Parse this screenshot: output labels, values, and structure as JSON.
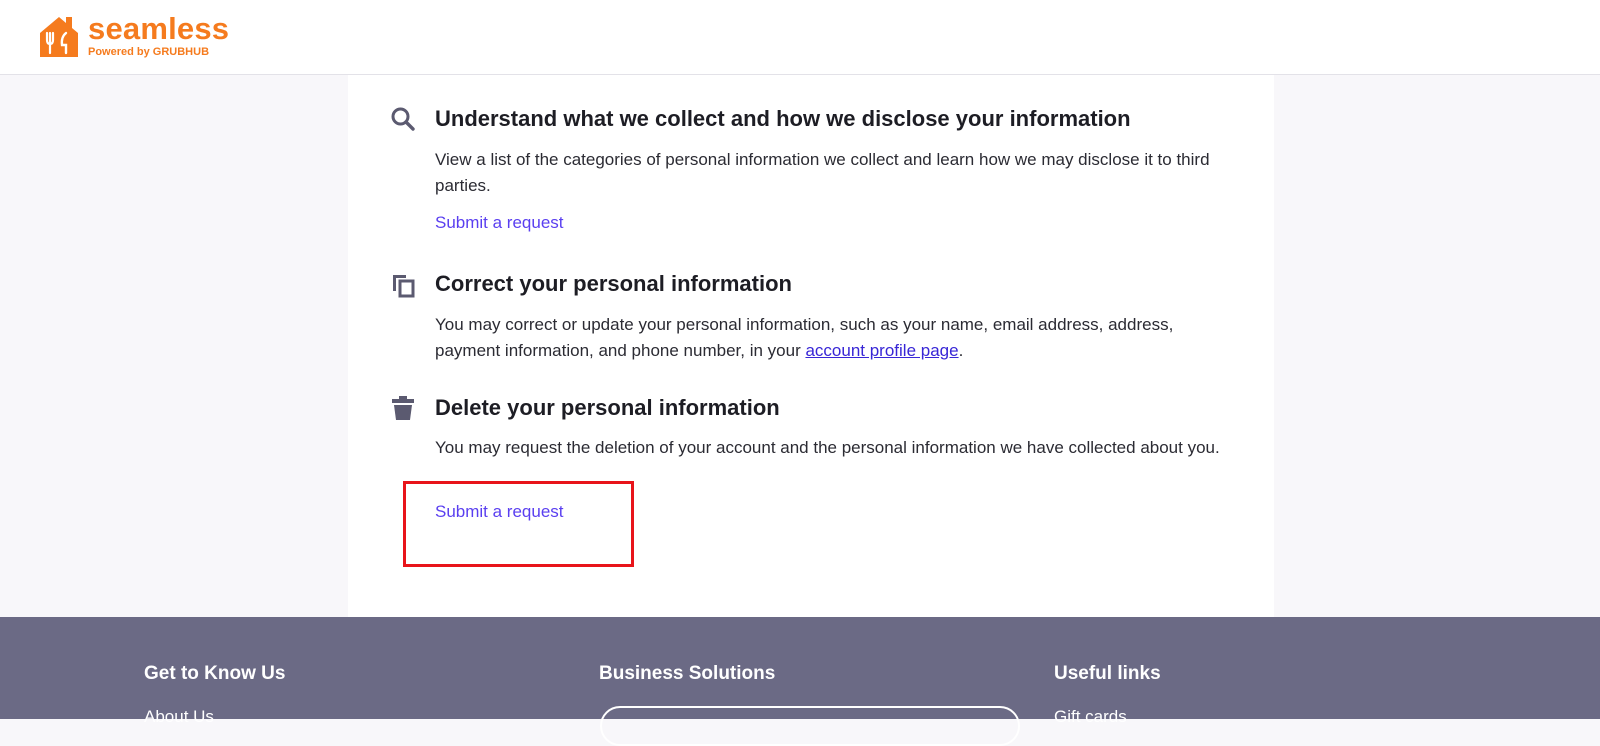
{
  "header": {
    "logo_word": "seamless",
    "logo_sub": "Powered by GRUBHUB",
    "brand_color": "#f57b1e"
  },
  "sections": [
    {
      "icon": "search-icon",
      "title": "Understand what we collect and how we disclose your information",
      "body": "View a list of the categories of personal information we collect and learn how we may disclose it to third parties.",
      "link": "Submit a request"
    },
    {
      "icon": "copy-icon",
      "title": "Correct your personal information",
      "body_prefix": "You may correct or update your personal information, such as your name, email address, address, payment information, and phone number, in your ",
      "body_link": "account profile page",
      "body_suffix": "."
    },
    {
      "icon": "trash-icon",
      "title": "Delete your personal information",
      "body": "You may request the deletion of your account and the personal information we have collected about you.",
      "link": "Submit a request"
    }
  ],
  "footer": {
    "columns": [
      {
        "heading": "Get to Know Us",
        "first_link": "About Us"
      },
      {
        "heading": "Business Solutions"
      },
      {
        "heading": "Useful links",
        "first_link": "Gift cards"
      }
    ],
    "background": "#6b6a85"
  },
  "colors": {
    "link": "#5a3ff0",
    "highlight": "#e8141a"
  }
}
